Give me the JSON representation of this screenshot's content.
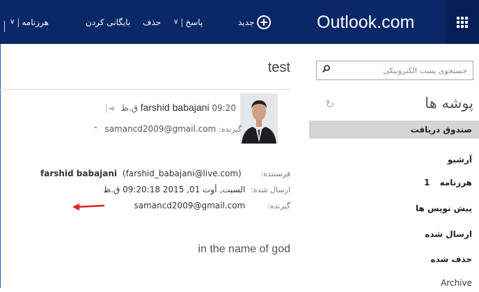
{
  "app": {
    "brand": "Outlook.com"
  },
  "toolbar": {
    "new_label": "جدید",
    "reply_label": "پاسخ",
    "delete_label": "حذف",
    "archive_label": "بایگانی کردن",
    "junk_label": "هرزنامه",
    "chevron": "∨"
  },
  "search": {
    "placeholder": "جستجوی پست الکترونیکی"
  },
  "folders": {
    "title": "پوشه ها",
    "items": [
      {
        "label": "صندوق دریافت",
        "count": "",
        "selected": true
      },
      {
        "label": "آرشیو",
        "count": ""
      },
      {
        "label": "هرزنامه",
        "count": "1"
      },
      {
        "label": "پیش نویس ها",
        "count": ""
      },
      {
        "label": "ارسال شده",
        "count": ""
      },
      {
        "label": "حذف شده",
        "count": ""
      },
      {
        "label": "Archive",
        "count": ""
      }
    ]
  },
  "message": {
    "subject": "test",
    "from_name": "farshid babajani",
    "time": "09:20 ق.ظ",
    "to_label": "گیرنده:",
    "to_short": "samancd2009@gmail.com",
    "details": {
      "sender_label": "فرستنده:",
      "sender_name": "farshid babajani",
      "sender_email": "(farshid_babajani@live.com)",
      "sent_label": "ارسال شده:",
      "sent_value": "السبت, أوت 01, 2015 09:20:18 ق.ظ",
      "recipient_label": "گیرنده:",
      "recipient_value": "samancd2009@gmail.com"
    },
    "body": "in the name of god"
  },
  "colors": {
    "topbar": "#0a2767",
    "selected_folder": "#d4d4d4",
    "annotation_arrow": "#e02020"
  }
}
